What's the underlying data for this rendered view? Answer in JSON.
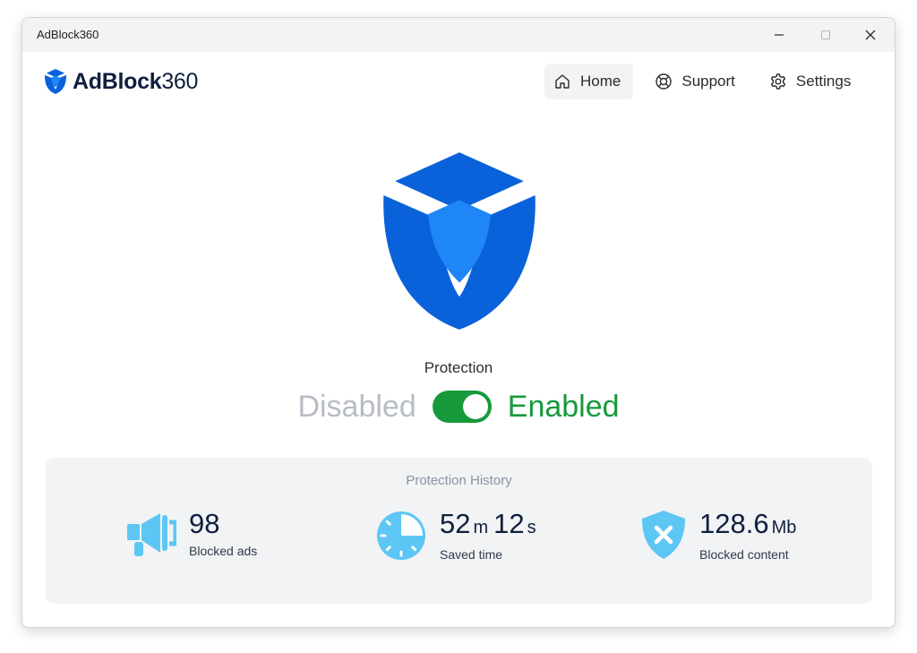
{
  "window": {
    "title": "AdBlock360"
  },
  "brand": {
    "name_bold": "AdBlock",
    "name_light": "360"
  },
  "nav": [
    {
      "label": "Home",
      "icon": "home-icon",
      "active": true
    },
    {
      "label": "Support",
      "icon": "lifebuoy-icon",
      "active": false
    },
    {
      "label": "Settings",
      "icon": "gear-icon",
      "active": false
    }
  ],
  "protection": {
    "label": "Protection",
    "off_label": "Disabled",
    "on_label": "Enabled",
    "enabled": true
  },
  "history": {
    "title": "Protection History",
    "stats": [
      {
        "value": "98",
        "label": "Blocked ads",
        "icon": "megaphone-icon"
      },
      {
        "value_a": "52",
        "unit_a": "m",
        "value_b": "12",
        "unit_b": "s",
        "label": "Saved time",
        "icon": "clock-icon"
      },
      {
        "value": "128.6",
        "unit": "Mb",
        "label": "Blocked content",
        "icon": "shield-x-icon"
      }
    ]
  },
  "colors": {
    "brand_blue": "#0a62db",
    "brand_light_blue": "#1e86f7",
    "enabled_green": "#169a3b",
    "disabled_gray": "#b7bcc4",
    "stat_icon_blue": "#5ec6f5"
  }
}
